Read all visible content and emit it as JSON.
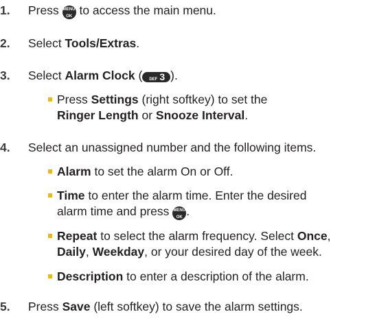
{
  "steps": [
    {
      "num": "1.",
      "pre": "Press ",
      "post": " to access the main menu."
    },
    {
      "num": "2.",
      "pre": "Select ",
      "bold": "Tools/Extras",
      "post": "."
    },
    {
      "num": "3.",
      "pre": "Select ",
      "bold": "Alarm Clock",
      "post": " (",
      "post2": ")."
    },
    {
      "num": "4.",
      "text": "Select an unassigned number and the following items."
    },
    {
      "num": "5.",
      "pre": "Press ",
      "bold": "Save",
      "post": " (left softkey) to save the alarm settings."
    }
  ],
  "sub3": {
    "pre": "Press ",
    "bold1": "Settings",
    "mid": " (right softkey) to set the",
    "bold2": "Ringer Length",
    "or": " or ",
    "bold3": "Snooze Interval",
    "end": "."
  },
  "sub4": [
    {
      "bold": "Alarm",
      "text": " to set the alarm On or Off."
    },
    {
      "bold": "Time",
      "text": " to enter the alarm time. Enter the desired",
      "line2": "alarm time and press ",
      "line2_end": "."
    },
    {
      "bold": "Repeat",
      "text": " to select the alarm frequency. Select ",
      "bold_b": "Once",
      "text_b": ",",
      "line2_b1": "Daily",
      "sep1": ", ",
      "line2_b2": "Weekday",
      "line2_rest": ", or your desired day of the week."
    },
    {
      "bold": "Description",
      "text": " to enter a description of the alarm."
    }
  ],
  "keys": {
    "menu_top": "MENU",
    "menu_bottom": "OK",
    "def_small": "DEF",
    "def_big": "3"
  },
  "colors": {
    "bullet": "#f5b800",
    "text": "#231f20",
    "key": "#2a2a2a"
  }
}
